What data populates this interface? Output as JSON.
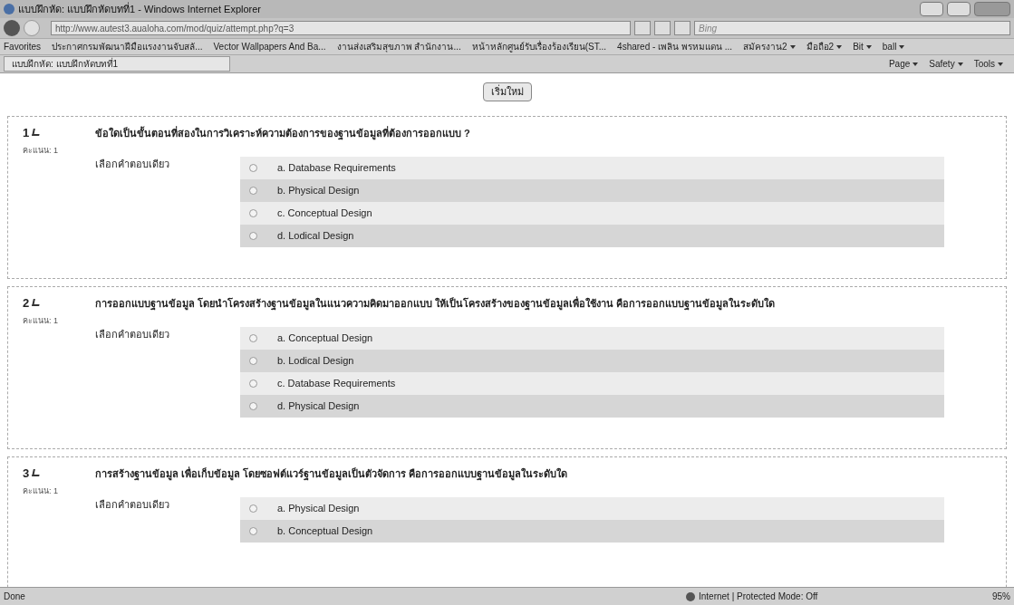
{
  "window": {
    "title": "แบบฝึกหัด: แบบฝึกหัดบทที่1 - Windows Internet Explorer"
  },
  "address_bar": {
    "url": "http://www.autest3.aualoha.com/mod/quiz/attempt.php?q=3",
    "search_placeholder": "Bing"
  },
  "favorites_bar": {
    "label": "Favorites",
    "items": [
      {
        "label": "ประกาศกรมพัฒนาฝีมือแรงงานจับสลั..."
      },
      {
        "label": "Vector Wallpapers And Ba..."
      },
      {
        "label": "งานส่งเสริมสุขภาพ สำนักงาน..."
      },
      {
        "label": "หน้าหลักศูนย์รับเรื่องร้องเรียน(ST..."
      },
      {
        "label": "4shared - เพลิน พรหมแดน ..."
      },
      {
        "label": "สมัครงาน2",
        "menu": true
      },
      {
        "label": "มือถือ2",
        "menu": true
      },
      {
        "label": "Bit",
        "menu": true
      },
      {
        "label": "ball",
        "menu": true
      }
    ]
  },
  "tab": {
    "title": "แบบฝึกหัด: แบบฝึกหัดบทที่1"
  },
  "command_bar": [
    "Page",
    "Safety",
    "Tools"
  ],
  "restart_button": "เริ่มใหม่",
  "questions": [
    {
      "number": "1",
      "marks": "คะแนน: 1",
      "text": "ข้อใดเป็นขั้นตอนที่สองในการวิเคราะห์ความต้องการของฐานข้อมูลที่ต้องการออกแบบ ?",
      "prompt": "เลือกคำตอบเดียว",
      "options": [
        {
          "label": "a. Database Requirements",
          "selected": false
        },
        {
          "label": "b. Physical Design",
          "selected": false
        },
        {
          "label": "c. Conceptual Design",
          "selected": false
        },
        {
          "label": "d. Lodical Design",
          "selected": false
        }
      ]
    },
    {
      "number": "2",
      "marks": "คะแนน: 1",
      "text": "การออกแบบฐานข้อมูล โดยนำโครงสร้างฐานข้อมูลในแนวความคิดมาออกแบบ ให้เป็นโครงสร้างของฐานข้อมูลเพื่อใช้งาน คือการออกแบบฐานข้อมูลในระดับใด",
      "prompt": "เลือกคำตอบเดียว",
      "options": [
        {
          "label": "a. Conceptual Design",
          "selected": false
        },
        {
          "label": "b. Lodical Design",
          "selected": false
        },
        {
          "label": "c. Database Requirements",
          "selected": false
        },
        {
          "label": "d. Physical Design",
          "selected": false
        }
      ]
    },
    {
      "number": "3",
      "marks": "คะแนน: 1",
      "text": "การสร้างฐานข้อมูล เพื่อเก็บข้อมูล โดยซอฟต์แวร์ฐานข้อมูลเป็นตัวจัดการ คือการออกแบบฐานข้อมูลในระดับใด",
      "prompt": "เลือกคำตอบเดียว",
      "options": [
        {
          "label": "a. Physical Design",
          "selected": false
        },
        {
          "label": "b. Conceptual Design",
          "selected": false
        }
      ]
    }
  ],
  "status_bar": {
    "status": "Done",
    "zone": "Internet | Protected Mode: Off",
    "zoom": "95%"
  }
}
